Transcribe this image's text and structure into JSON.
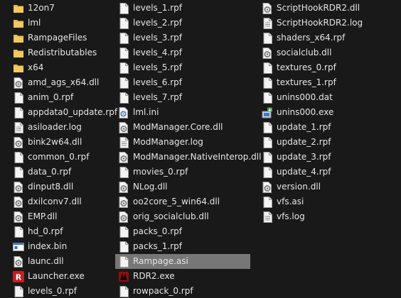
{
  "columns": [
    [
      {
        "name": "12on7",
        "icon": "folder"
      },
      {
        "name": "lml",
        "icon": "folder"
      },
      {
        "name": "RampageFiles",
        "icon": "folder"
      },
      {
        "name": "Redistributables",
        "icon": "folder"
      },
      {
        "name": "x64",
        "icon": "folder"
      },
      {
        "name": "amd_ags_x64.dll",
        "icon": "dll"
      },
      {
        "name": "anim_0.rpf",
        "icon": "file"
      },
      {
        "name": "appdata0_update.rpf",
        "icon": "file"
      },
      {
        "name": "asiloader.log",
        "icon": "text"
      },
      {
        "name": "bink2w64.dll",
        "icon": "dll"
      },
      {
        "name": "common_0.rpf",
        "icon": "file"
      },
      {
        "name": "data_0.rpf",
        "icon": "file"
      },
      {
        "name": "dinput8.dll",
        "icon": "dll"
      },
      {
        "name": "dxilconv7.dll",
        "icon": "dll"
      },
      {
        "name": "EMP.dll",
        "icon": "dll"
      },
      {
        "name": "hd_0.rpf",
        "icon": "file"
      },
      {
        "name": "index.bin",
        "icon": "bin"
      },
      {
        "name": "launc.dll",
        "icon": "dll"
      },
      {
        "name": "Launcher.exe",
        "icon": "launcher"
      },
      {
        "name": "levels_0.rpf",
        "icon": "file"
      }
    ],
    [
      {
        "name": "levels_1.rpf",
        "icon": "file"
      },
      {
        "name": "levels_2.rpf",
        "icon": "file"
      },
      {
        "name": "levels_3.rpf",
        "icon": "file"
      },
      {
        "name": "levels_4.rpf",
        "icon": "file"
      },
      {
        "name": "levels_5.rpf",
        "icon": "file"
      },
      {
        "name": "levels_6.rpf",
        "icon": "file"
      },
      {
        "name": "levels_7.rpf",
        "icon": "file"
      },
      {
        "name": "lml.ini",
        "icon": "ini"
      },
      {
        "name": "ModManager.Core.dll",
        "icon": "dll"
      },
      {
        "name": "ModManager.log",
        "icon": "text"
      },
      {
        "name": "ModManager.NativeInterop.dll",
        "icon": "dll"
      },
      {
        "name": "movies_0.rpf",
        "icon": "file"
      },
      {
        "name": "NLog.dll",
        "icon": "dll"
      },
      {
        "name": "oo2core_5_win64.dll",
        "icon": "dll"
      },
      {
        "name": "orig_socialclub.dll",
        "icon": "dll"
      },
      {
        "name": "packs_0.rpf",
        "icon": "file"
      },
      {
        "name": "packs_1.rpf",
        "icon": "file"
      },
      {
        "name": "Rampage.asi",
        "icon": "file",
        "selected": true
      },
      {
        "name": "RDR2.exe",
        "icon": "rdr2"
      },
      {
        "name": "rowpack_0.rpf",
        "icon": "file"
      }
    ],
    [
      {
        "name": "ScriptHookRDR2.dll",
        "icon": "dll"
      },
      {
        "name": "ScriptHookRDR2.log",
        "icon": "text"
      },
      {
        "name": "shaders_x64.rpf",
        "icon": "file"
      },
      {
        "name": "socialclub.dll",
        "icon": "dll"
      },
      {
        "name": "textures_0.rpf",
        "icon": "file"
      },
      {
        "name": "textures_1.rpf",
        "icon": "file"
      },
      {
        "name": "unins000.dat",
        "icon": "file"
      },
      {
        "name": "unins000.exe",
        "icon": "installer"
      },
      {
        "name": "update_1.rpf",
        "icon": "file"
      },
      {
        "name": "update_2.rpf",
        "icon": "file"
      },
      {
        "name": "update_3.rpf",
        "icon": "file"
      },
      {
        "name": "update_4.rpf",
        "icon": "file"
      },
      {
        "name": "version.dll",
        "icon": "dll"
      },
      {
        "name": "vfs.asi",
        "icon": "file"
      },
      {
        "name": "vfs.log",
        "icon": "text"
      }
    ]
  ],
  "colors": {
    "background": "#191919",
    "text": "#e6e6e6",
    "selection": "#777777",
    "folder": "#e8b84a",
    "launcher_red": "#c22020",
    "rdr2_red": "#8c1010"
  }
}
